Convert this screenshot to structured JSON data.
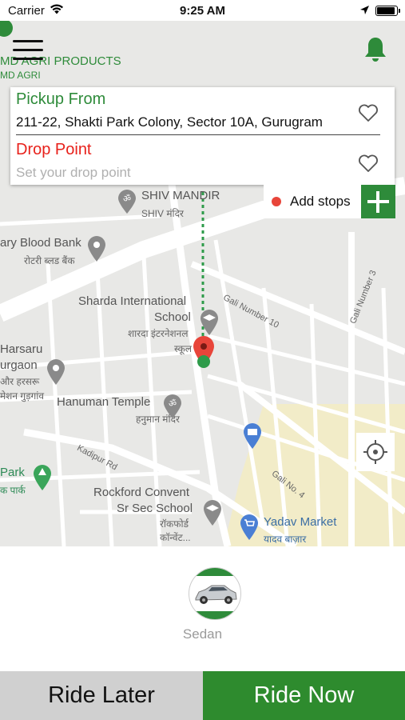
{
  "status_bar": {
    "carrier": "Carrier",
    "time": "9:25 AM"
  },
  "header": {
    "brand_name": "MD AGRI PRODUCTS",
    "brand_sub": "MD AGRI"
  },
  "location_card": {
    "pickup_label": "Pickup From",
    "pickup_value": "211-22, Shakti Park Colony, Sector 10A, Gurugram",
    "drop_label": "Drop Point",
    "drop_placeholder": "Set your drop point"
  },
  "add_stops": {
    "label": "Add stops"
  },
  "map": {
    "places": {
      "shiv_mandir": "SHIV MANDIR",
      "shiv_mandir_hi": "SHIV मंदिर",
      "blood_bank": "ary Blood Bank",
      "blood_bank_hi": "रोटरी ब्लड बैंक",
      "school_1": "Sharda International",
      "school_2": "School",
      "school_hi_1": "शारदा इंटरनेशनल",
      "school_hi_2": "स्कूल",
      "harsaru_1": "Harsaru",
      "harsaru_2": "urgaon",
      "harsaru_hi_1": "और हरसरू",
      "harsaru_hi_2": "मेशन गुड़गांव",
      "hanuman": "Hanuman Temple",
      "hanuman_hi": "हनुमान मंदिर",
      "park": "Park",
      "park_hi": "क पार्क",
      "rockford_1": "Rockford Convent",
      "rockford_2": "Sr Sec School",
      "rockford_hi_1": "रॉकफोर्ड",
      "rockford_hi_2": "कॉन्वेंट...",
      "yadav": "Yadav Market",
      "yadav_hi": "यादव बाज़ार"
    },
    "roads": {
      "gali_10": "Gali Number 10",
      "gali_3": "Gali Number 3",
      "kadipur": "Kadipur Rd",
      "gali_4": "Gali No. 4"
    }
  },
  "vehicle": {
    "label": "Sedan"
  },
  "actions": {
    "ride_later": "Ride Later",
    "ride_now": "Ride Now"
  },
  "colors": {
    "brand_green": "#2e8b3a",
    "drop_red": "#e8211b",
    "pin_red": "#e8453a"
  }
}
